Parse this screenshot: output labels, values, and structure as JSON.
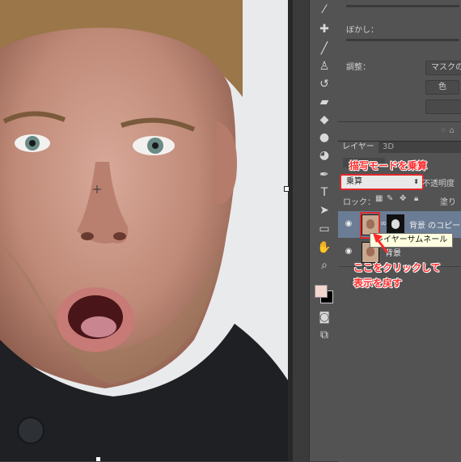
{
  "canvas": {
    "subject": "surprised man photo",
    "background_color": "#e9eaec"
  },
  "properties_panel": {
    "blur_label": "ぼかし：",
    "adjust_label": "調整：",
    "mask_button": "マスクの",
    "color_button": "色"
  },
  "layers_panel": {
    "tabs": [
      {
        "label": "レイヤー"
      },
      {
        "label": "3D"
      }
    ],
    "blend_mode": "乗算",
    "opacity_label": "不透明度",
    "lock_label": "ロック：",
    "fill_label": "塗り",
    "layers": [
      {
        "name": "背景 のコピー",
        "selected": true
      },
      {
        "name": "背景",
        "selected": false
      }
    ]
  },
  "tooltip": "レイヤーサムネール",
  "annotations": {
    "blend_note": "描写モードを乗算",
    "click_note_line1": "ここをクリックして",
    "click_note_line2": "表示を戻す"
  },
  "colors": {
    "highlight": "#e0282b",
    "annotation": "#ff2a2a",
    "selected_layer": "#6a7d94",
    "panel": "#535353"
  },
  "tools": [
    "eyedropper-icon",
    "healing-icon",
    "brush-icon",
    "stamp-icon",
    "history-brush-icon",
    "eraser-icon",
    "paint-bucket-icon",
    "blur-icon",
    "dodge-icon",
    "pen-icon",
    "type-icon",
    "path-select-icon",
    "rectangle-icon",
    "hand-icon",
    "zoom-icon",
    "color-swatch-icon",
    "quickmask-icon",
    "screen-mode-icon"
  ]
}
